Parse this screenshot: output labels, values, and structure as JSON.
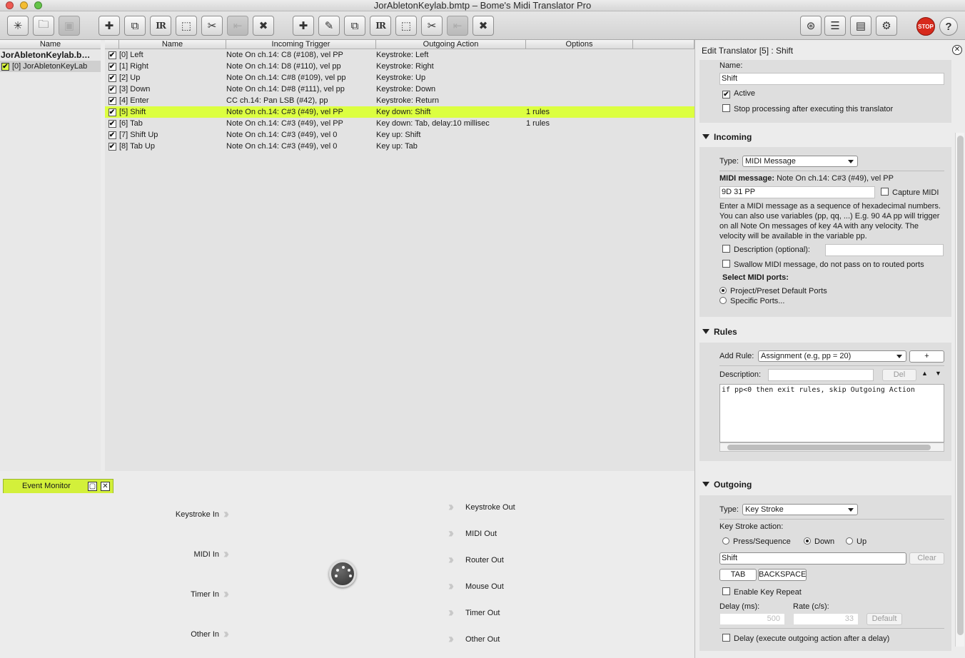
{
  "window": {
    "title": "JorAbletonKeylab.bmtp – Bome's Midi Translator Pro"
  },
  "project_pane": {
    "header": "Name",
    "project_title": "JorAbletonKeylab.b…",
    "presets": [
      {
        "label": "[0] JorAbletonKeyLab",
        "active": true
      }
    ]
  },
  "translators": {
    "headers": [
      "Name",
      "Incoming Trigger",
      "Outgoing Action",
      "Options"
    ],
    "rows": [
      {
        "name": "[0] Left",
        "incoming": "Note On ch.14: C8 (#108), vel PP",
        "outgoing": "Keystroke: Left",
        "options": ""
      },
      {
        "name": "[1] Right",
        "incoming": "Note On ch.14: D8 (#110), vel pp",
        "outgoing": "Keystroke: Right",
        "options": ""
      },
      {
        "name": "[2] Up",
        "incoming": "Note On ch.14: C#8 (#109), vel pp",
        "outgoing": "Keystroke: Up",
        "options": ""
      },
      {
        "name": "[3] Down",
        "incoming": "Note On ch.14: D#8 (#111), vel pp",
        "outgoing": "Keystroke: Down",
        "options": ""
      },
      {
        "name": "[4] Enter",
        "incoming": "CC ch.14: Pan LSB (#42), pp",
        "outgoing": "Keystroke: Return",
        "options": ""
      },
      {
        "name": "[5] Shift",
        "incoming": "Note On ch.14: C#3 (#49), vel PP",
        "outgoing": "Key down: Shift",
        "options": "1 rules"
      },
      {
        "name": "[6] Tab",
        "incoming": "Note On ch.14: C#3 (#49), vel PP",
        "outgoing": "Key down: Tab, delay:10 millisec",
        "options": "1 rules"
      },
      {
        "name": "[7] Shift Up",
        "incoming": "Note On ch.14: C#3 (#49), vel 0",
        "outgoing": "Key up: Shift",
        "options": ""
      },
      {
        "name": "[8] Tab Up",
        "incoming": "Note On ch.14: C#3 (#49), vel 0",
        "outgoing": "Key up: Tab",
        "options": ""
      }
    ]
  },
  "event_monitor": {
    "tab_label": "Event Monitor",
    "inputs": [
      "Keystroke In",
      "MIDI In",
      "Timer In",
      "Other In"
    ],
    "outputs": [
      "Keystroke Out",
      "MIDI Out",
      "Router Out",
      "Mouse Out",
      "Timer Out",
      "Other Out"
    ]
  },
  "edit": {
    "title": "Edit Translator [5] : Shift",
    "name_label": "Name:",
    "name_value": "Shift",
    "active_label": "Active",
    "stop_label": "Stop processing after executing this translator",
    "incoming": {
      "header": "Incoming",
      "type_label": "Type:",
      "type_value": "MIDI Message",
      "midi_label": "MIDI message:",
      "midi_value": "Note On ch.14: C#3 (#49), vel PP",
      "hex_value": "9D 31 PP",
      "capture_label": "Capture MIDI",
      "help": "Enter a MIDI message as a sequence of hexadecimal numbers. You can also use variables (pp, qq, ...) E.g. 90 4A pp will trigger on all Note On messages of key 4A with any velocity. The velocity will be available in the variable pp.",
      "desc_label": "Description (optional):",
      "swallow_label": "Swallow MIDI message, do not pass on to routed ports",
      "ports_label": "Select MIDI ports:",
      "port_opt1": "Project/Preset Default Ports",
      "port_opt2": "Specific Ports..."
    },
    "rules": {
      "header": "Rules",
      "add_label": "Add Rule:",
      "add_value": "Assignment (e.g, pp = 20)",
      "plus": "+",
      "desc_label": "Description:",
      "del": "Del",
      "text": "if pp<0 then exit rules, skip Outgoing Action"
    },
    "outgoing": {
      "header": "Outgoing",
      "type_label": "Type:",
      "type_value": "Key Stroke",
      "action_label": "Key Stroke action:",
      "opt_press": "Press/Sequence",
      "opt_down": "Down",
      "opt_up": "Up",
      "key_value": "Shift",
      "clear": "Clear",
      "tab_btn": "TAB",
      "backspace_btn": "BACKSPACE",
      "repeat_label": "Enable Key Repeat",
      "delay_label": "Delay (ms):",
      "rate_label": "Rate (c/s):",
      "delay_value": "500",
      "rate_value": "33",
      "default_btn": "Default",
      "delay_exec_label": "Delay (execute outgoing action after a delay)"
    }
  },
  "toolbar": {
    "stop": "STOP",
    "help": "?"
  },
  "colors": {
    "highlight": "#dcff40",
    "stop": "#d72a1c"
  }
}
